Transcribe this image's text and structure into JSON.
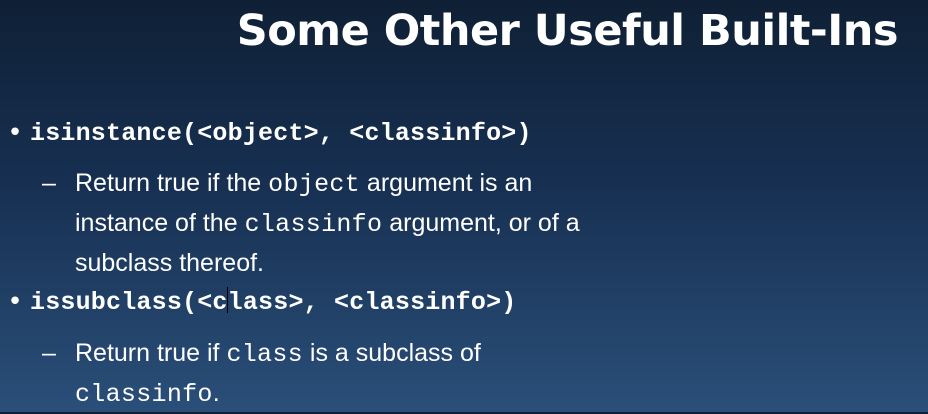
{
  "slide": {
    "title": "Some Other Useful Built-Ins",
    "bullets": [
      {
        "symbol": "•",
        "heading": "isinstance(<object>, <classinfo>)",
        "sub": {
          "dash": "–",
          "line1_text_a": "Return true if the ",
          "line1_code": "object",
          "line1_text_b": " argument is an",
          "line2_text_a": "instance of the ",
          "line2_code": "classinfo",
          "line2_text_b": " argument, or of a",
          "line3_text": "subclass thereof."
        }
      },
      {
        "symbol": "•",
        "heading_a": "issubclass(<c",
        "heading_b": "lass>, <classinfo>)",
        "sub": {
          "dash": "–",
          "line1_text_a": "Return true if ",
          "line1_code": "class",
          "line1_text_b": " is a subclass of",
          "line2_code": "classinfo",
          "line2_text": "."
        }
      }
    ]
  }
}
